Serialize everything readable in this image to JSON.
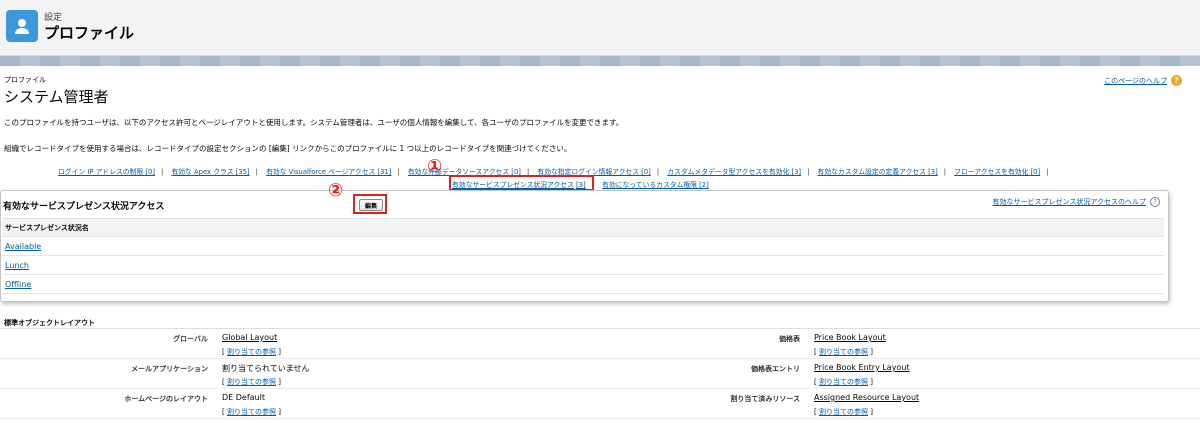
{
  "header": {
    "small": "設定",
    "title": "プロファイル"
  },
  "page": {
    "label": "プロファイル",
    "title": "システム管理者",
    "help": "このページのヘルプ",
    "desc1": "このプロファイルを持つユーザは、以下のアクセス許可とページレイアウトと使用します。システム管理者は、ユーザの個人情報を編集して、各ユーザのプロファイルを変更できます。",
    "desc2": "組織でレコードタイプを使用する場合は、レコードタイプの設定セクションの [編集] リンクからこのプロファイルに 1 つ以上のレコードタイプを関連づけてください。"
  },
  "related_links": {
    "row1": [
      "ログイン IP アドレスの制限 [0]",
      "有効な Apex クラス [35]",
      "有効な Visualforce ページアクセス [31]",
      "有効な外部データソースアクセス [0]",
      "有効な指定ログイン情報アクセス [0]",
      "カスタムメタデータ型アクセスを有効化 [3]",
      "有効なカスタム設定の定義アクセス [3]",
      "フローアクセスを有効化 [0]"
    ],
    "row2": [
      "有効なサービスプレゼンス状況アクセス",
      "[3]",
      "有効になっているカスタム権限 [2]"
    ]
  },
  "annotations": {
    "mark1": "①",
    "mark2": "②"
  },
  "panel": {
    "title": "有効なサービスプレゼンス状況アクセス",
    "edit_label": "編集",
    "help": "有効なサービスプレゼンス状況アクセスのヘルプ",
    "column": "サービスプレゼンス状況名",
    "rows": [
      "Available",
      "Lunch",
      "Offline"
    ]
  },
  "layouts": {
    "title": "標準オブジェクトレイアウト",
    "assign_text": "割り当ての参照",
    "rows": [
      {
        "left_label": "グローバル",
        "left_value": "Global Layout",
        "left_link": true,
        "right_label": "価格表",
        "right_value": "Price Book Layout"
      },
      {
        "left_label": "メールアプリケーション",
        "left_value": "割り当てられていません",
        "left_link": false,
        "right_label": "価格表エントリ",
        "right_value": "Price Book Entry Layout"
      },
      {
        "left_label": "ホームページのレイアウト",
        "left_value": "DE Default",
        "left_link": false,
        "right_label": "割り当て済みリソース",
        "right_value": "Assigned Resource Layout"
      }
    ]
  },
  "colors": {
    "accent": "#3c97dd",
    "link": "#015ba7",
    "highlight": "#e02020"
  },
  "icons": [
    "user-icon",
    "help-icon"
  ]
}
